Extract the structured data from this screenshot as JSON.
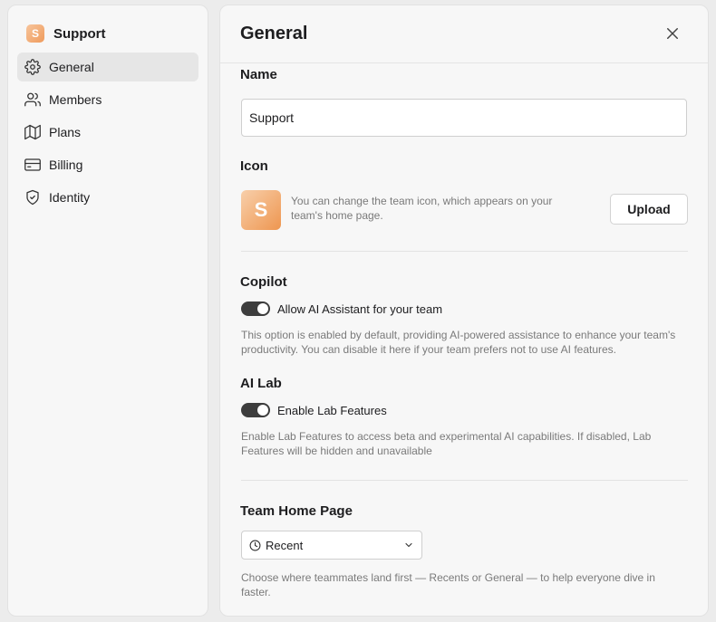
{
  "team": {
    "name": "Support",
    "logo_letter": "S",
    "accent": "#ef9b5c"
  },
  "nav": {
    "items": [
      {
        "label": "General",
        "icon": "gear-icon",
        "active": true
      },
      {
        "label": "Members",
        "icon": "users-icon"
      },
      {
        "label": "Plans",
        "icon": "map-icon"
      },
      {
        "label": "Billing",
        "icon": "credit-card-icon"
      },
      {
        "label": "Identity",
        "icon": "shield-check-icon"
      }
    ]
  },
  "panel": {
    "title": "General",
    "name_section": {
      "label": "Name",
      "value": "Support"
    },
    "icon_section": {
      "label": "Icon",
      "letter": "S",
      "description": "You can change the team icon, which appears on your team's home page.",
      "upload_label": "Upload"
    },
    "copilot": {
      "label": "Copilot",
      "toggle_label": "Allow AI Assistant for your team",
      "enabled": true,
      "help": "This option is enabled by default, providing AI-powered assistance to enhance your team's productivity. You can disable it here if your team prefers not to use AI features."
    },
    "ai_lab": {
      "label": "AI Lab",
      "toggle_label": "Enable Lab Features",
      "enabled": true,
      "help": "Enable Lab Features to access beta and experimental AI capabilities. If disabled, Lab Features will be hidden and unavailable"
    },
    "home_page": {
      "label": "Team Home Page",
      "selected": "Recent",
      "help": "Choose where teammates land first — Recents or General — to help everyone dive in faster."
    }
  }
}
